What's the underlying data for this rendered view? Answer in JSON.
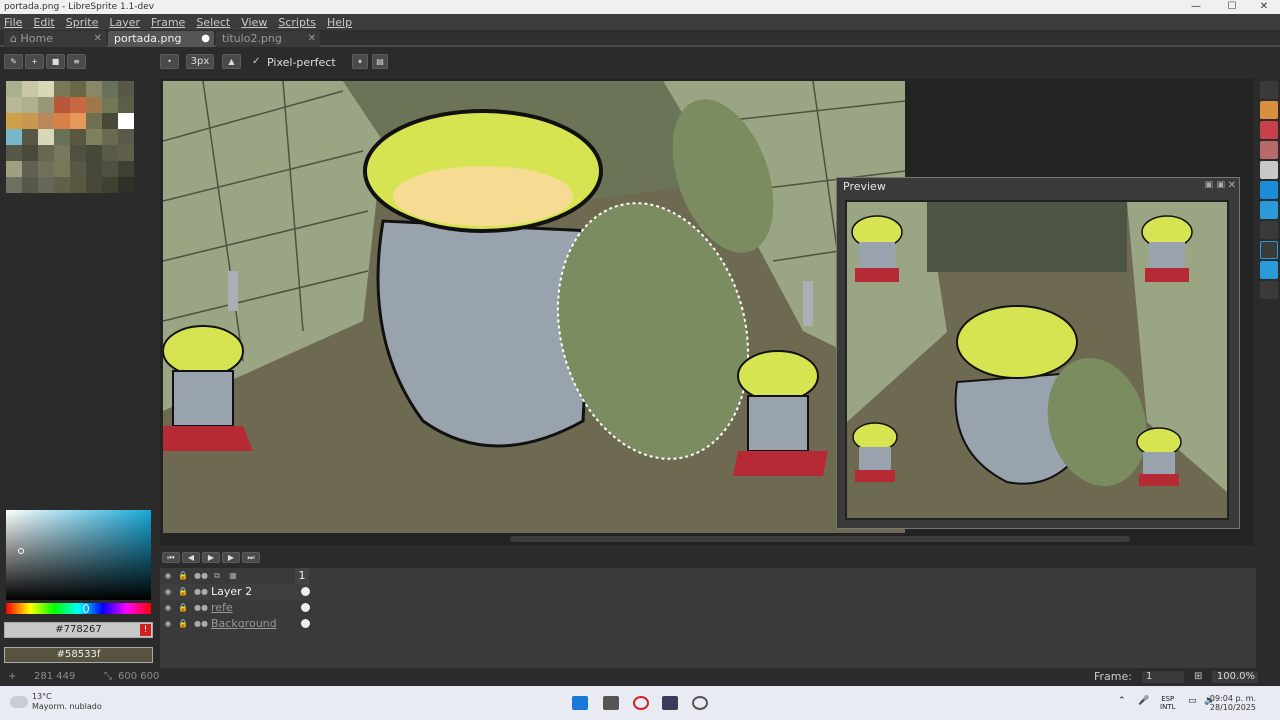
{
  "window": {
    "title": "portada.png - LibreSprite 1.1-dev",
    "controls": [
      "—",
      "☐",
      "✕"
    ]
  },
  "menu": [
    "File",
    "Edit",
    "Sprite",
    "Layer",
    "Frame",
    "Select",
    "View",
    "Scripts",
    "Help"
  ],
  "tabs": [
    {
      "label": "Home",
      "icon": "home-icon"
    },
    {
      "label": "portada.png",
      "modified": true
    },
    {
      "label": "titulo2.png"
    }
  ],
  "toolbar": {
    "brush_size": "3px",
    "pixel_perfect_label": "Pixel-perfect",
    "pixel_perfect_checked": true
  },
  "palette_colors": [
    "#a8b090",
    "#c8c8a8",
    "#d8d8b8",
    "#787858",
    "#686848",
    "#888868",
    "#687060",
    "#585848",
    "#b8b898",
    "#b0b090",
    "#989878",
    "#b85838",
    "#c86840",
    "#a07848",
    "#707858",
    "#586048",
    "#d0a048",
    "#c89850",
    "#b88858",
    "#d88048",
    "#e89858",
    "#707050",
    "#484838",
    "#ffffff",
    "#78b8c8",
    "#585848",
    "#d8d8b8",
    "#687058",
    "#585840",
    "#808060",
    "#6a6a52",
    "#5a5a48",
    "#585848",
    "#4a4a3a",
    "#686850",
    "#787860",
    "#505040",
    "#484838",
    "#5a5a48",
    "#606048",
    "#a0a080",
    "#606050",
    "#707058",
    "#787858",
    "#585848",
    "#484838",
    "#505040",
    "#404030",
    "#707060",
    "#585848",
    "#686858",
    "#606048",
    "#585840",
    "#484838",
    "#404030",
    "#303028"
  ],
  "color_picker": {
    "fg_hex": "#778267",
    "bg_hex": "#58533f",
    "fg_color": "#778267",
    "bg_color": "#58533f"
  },
  "preview": {
    "title": "Preview"
  },
  "layers": {
    "frame_number": "1",
    "items": [
      {
        "name": "Layer 2",
        "selected": true
      },
      {
        "name": "refe",
        "selected": false
      },
      {
        "name": "Background",
        "selected": false
      }
    ]
  },
  "status": {
    "cursor_pos": "281 449",
    "sprite_size": "600 600",
    "frame_label": "Frame:",
    "frame_value": "1",
    "zoom": "100.0%"
  },
  "taskbar": {
    "temperature": "13°C",
    "weather": "Mayorm. nublado",
    "lang1": "ESP",
    "lang2": "INTL",
    "time": "09:04 p. m.",
    "date": "28/10/2025"
  }
}
